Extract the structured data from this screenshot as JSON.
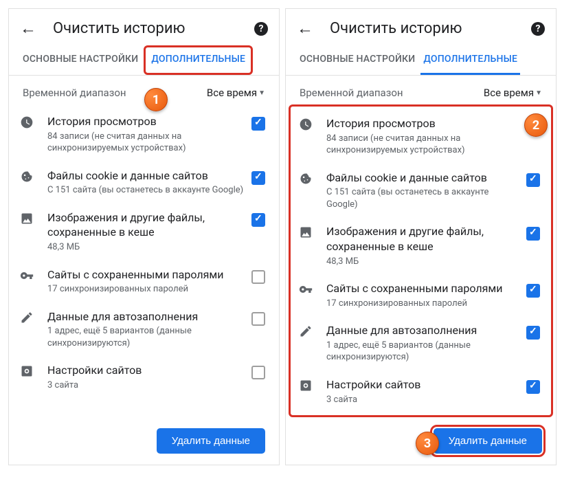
{
  "header": {
    "title": "Очистить историю"
  },
  "tabs": {
    "basic": "ОСНОВНЫЕ НАСТРОЙКИ",
    "advanced": "ДОПОЛНИТЕЛЬНЫЕ"
  },
  "timerange": {
    "label": "Временной диапазон",
    "value": "Все время"
  },
  "items": {
    "history": {
      "title": "История просмотров",
      "sub": "84 записи (не считая данных на синхронизируемых устройствах)"
    },
    "cookies": {
      "title": "Файлы cookie и данные сайтов",
      "sub": "С 151 сайта (вы останетесь в аккаунте Google)"
    },
    "cache": {
      "title": "Изображения и другие файлы, сохраненные в кеше",
      "sub": "48,3 МБ"
    },
    "passwords": {
      "title": "Сайты с сохраненными паролями",
      "sub": "17 синхронизированных паролей"
    },
    "autofill": {
      "title": "Данные для автозаполнения",
      "sub": "1 адрес, ещё 5 вариантов (данные синхронизируются)"
    },
    "sitesettings": {
      "title": "Настройки сайтов",
      "sub": "3 сайта"
    }
  },
  "button": {
    "delete": "Удалить данные"
  },
  "markers": {
    "m1": "1",
    "m2": "2",
    "m3": "3"
  },
  "screens": {
    "left": {
      "checked": [
        "history",
        "cookies",
        "cache"
      ],
      "itemsBoxed": false,
      "tabBoxed": true,
      "btnBoxed": false
    },
    "right": {
      "checked": [
        "history",
        "cookies",
        "cache",
        "passwords",
        "autofill",
        "sitesettings"
      ],
      "itemsBoxed": true,
      "tabBoxed": false,
      "btnBoxed": true
    }
  }
}
